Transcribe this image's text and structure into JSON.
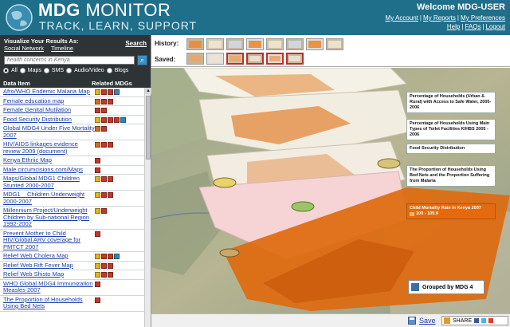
{
  "header": {
    "brand": "MDG",
    "brand_light": "MONITOR",
    "tagline": "TRACK, LEARN, SUPPORT",
    "welcome": "Welcome MDG-USER",
    "links": [
      {
        "label": "My Account"
      },
      {
        "label": "My Reports"
      },
      {
        "label": "My Preferences"
      },
      {
        "label": "Help"
      },
      {
        "label": "FAQs"
      },
      {
        "label": "Logout"
      }
    ]
  },
  "left": {
    "viz_label": "Visualize Your Results As:",
    "search_link": "Search",
    "social_network": "Social Network",
    "timeline": "Timeline",
    "search_placeholder": "health concerns in Kenya",
    "filters": [
      "All",
      "Maps",
      "SMS",
      "Audio/Video",
      "Blogs"
    ],
    "col_data_item": "Data Item",
    "col_related": "Related MDGs",
    "items": [
      {
        "label": "Afro/WHO Endemic Malaria Map",
        "badges": [
          "#e3b41b",
          "#c0392b",
          "#c0392b",
          "#4a7fb5"
        ]
      },
      {
        "label": "Female education map",
        "badges": [
          "#d86b1c",
          "#c0392b",
          "#c0392b"
        ]
      },
      {
        "label": "Female Genital Mutilation",
        "badges": [
          "#c0392b",
          "#c0392b"
        ]
      },
      {
        "label": "Food Security Distribution",
        "badges": [
          "#e3b41b",
          "#c0392b",
          "#c0392b",
          "#c0392b",
          "#2a8bb0"
        ]
      },
      {
        "label": "Global MDG4 Under Five Mortality 2007",
        "badges": [
          "#d86b1c",
          "#c0392b"
        ]
      },
      {
        "label": "HIV/AIDS linkages evidence review 2009 (document)",
        "badges": [
          "#d86b1c",
          "#c0392b",
          "#c0392b"
        ]
      },
      {
        "label": "Kenya Ethnic Map",
        "badges": [
          "#c0392b"
        ]
      },
      {
        "label": "Male circumcisions.com/Maps",
        "badges": [
          "#c0392b"
        ]
      },
      {
        "label": "Maps/Global MDG1 Children Stunted 2000-2007",
        "badges": [
          "#e3b41b",
          "#c0392b",
          "#c0392b"
        ]
      },
      {
        "label": "MDG1 _ Children Underweight 2000-2007",
        "badges": [
          "#e3b41b",
          "#c0392b",
          "#c0392b"
        ]
      },
      {
        "label": "Millennium Project/Underweight Children by Sub-national Region 1992-2002",
        "badges": [
          "#e3b41b",
          "#c0392b"
        ]
      },
      {
        "label": "Prevent Mother to Child HIV/Global ARV coverage for PMTCT 2007",
        "badges": [
          "#c0392b"
        ]
      },
      {
        "label": "Relief Web Cholera Map",
        "badges": [
          "#e3b41b",
          "#c0392b",
          "#c0392b",
          "#2a8bb0"
        ]
      },
      {
        "label": "Relief Web Rift Fever Map",
        "badges": [
          "#e3b41b",
          "#c0392b",
          "#c0392b"
        ]
      },
      {
        "label": "Relief Web Shisto Map",
        "badges": [
          "#e3b41b",
          "#c0392b",
          "#c0392b"
        ]
      },
      {
        "label": "WHO Global MDG4 Immunization Measles 2007",
        "badges": [
          "#c0392b"
        ]
      },
      {
        "label": "The Proportion of Households Using Bed Nets",
        "badges": [
          "#c0392b"
        ]
      }
    ]
  },
  "toolbar": {
    "history_label": "History:",
    "saved_label": "Saved:",
    "history_count": 8,
    "saved_count": 6
  },
  "map": {
    "layers": [
      "Percentage of Households (Urban & Rural) with Access to Safe Water, 2005-2006",
      "Percentage of Households Using Main Types of Toilet Facilities KIHBS 2005 - 2006",
      "Food Security Distribution",
      "The Proportion of Households Using Bed Nets and the Proportion Suffering from Malaria",
      "Child Mortality Rate in Kenya 2007"
    ],
    "legend_value": "100 - 109.9",
    "group_label": "Grouped by MDG 4"
  },
  "footer": {
    "save": "Save",
    "share": "SHARE"
  }
}
